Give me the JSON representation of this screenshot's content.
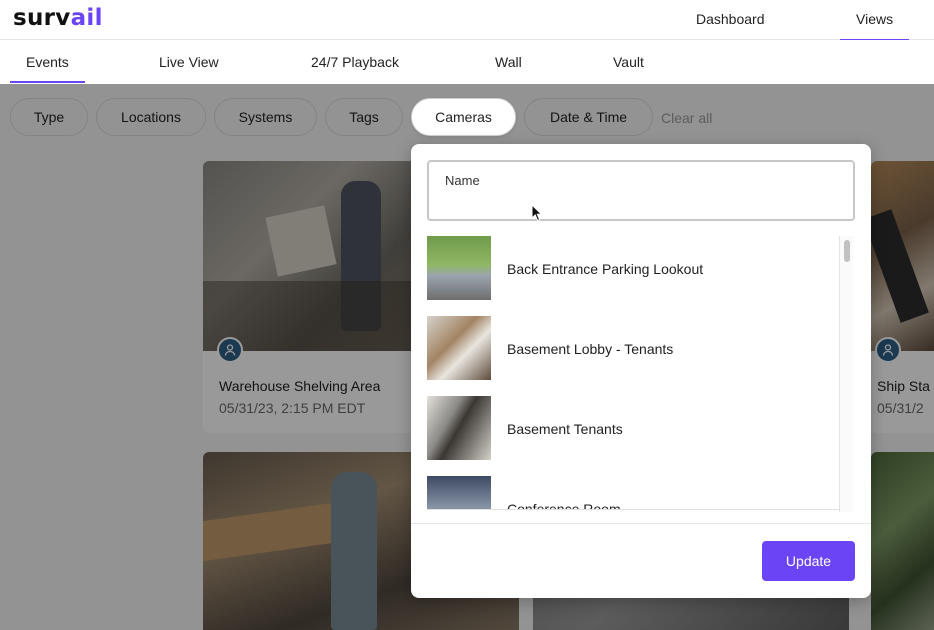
{
  "header": {
    "logo_prefix": "surv",
    "logo_accent": "ail",
    "nav": [
      "Dashboard",
      "Views"
    ],
    "active_nav": "Views"
  },
  "subnav": {
    "tabs": [
      "Events",
      "Live View",
      "24/7 Playback",
      "Wall",
      "Vault"
    ],
    "active_tab": "Events"
  },
  "filters": {
    "chips": [
      "Type",
      "Locations",
      "Systems",
      "Tags",
      "Cameras",
      "Date & Time"
    ],
    "active_chip": "Cameras",
    "clear_all": "Clear all"
  },
  "events": [
    {
      "title": "Warehouse Shelving Area",
      "time": "05/31/23, 2:15 PM EDT"
    },
    {
      "title": "Ship Sta",
      "time": "05/31/2"
    }
  ],
  "camera_dropdown": {
    "name_label": "Name",
    "name_value": "",
    "cameras": [
      "Back Entrance Parking Lookout",
      "Basement Lobby - Tenants",
      "Basement Tenants",
      "Conference Room"
    ],
    "update_label": "Update"
  },
  "colors": {
    "accent": "#6b45f5",
    "badge": "#2d5f88"
  }
}
